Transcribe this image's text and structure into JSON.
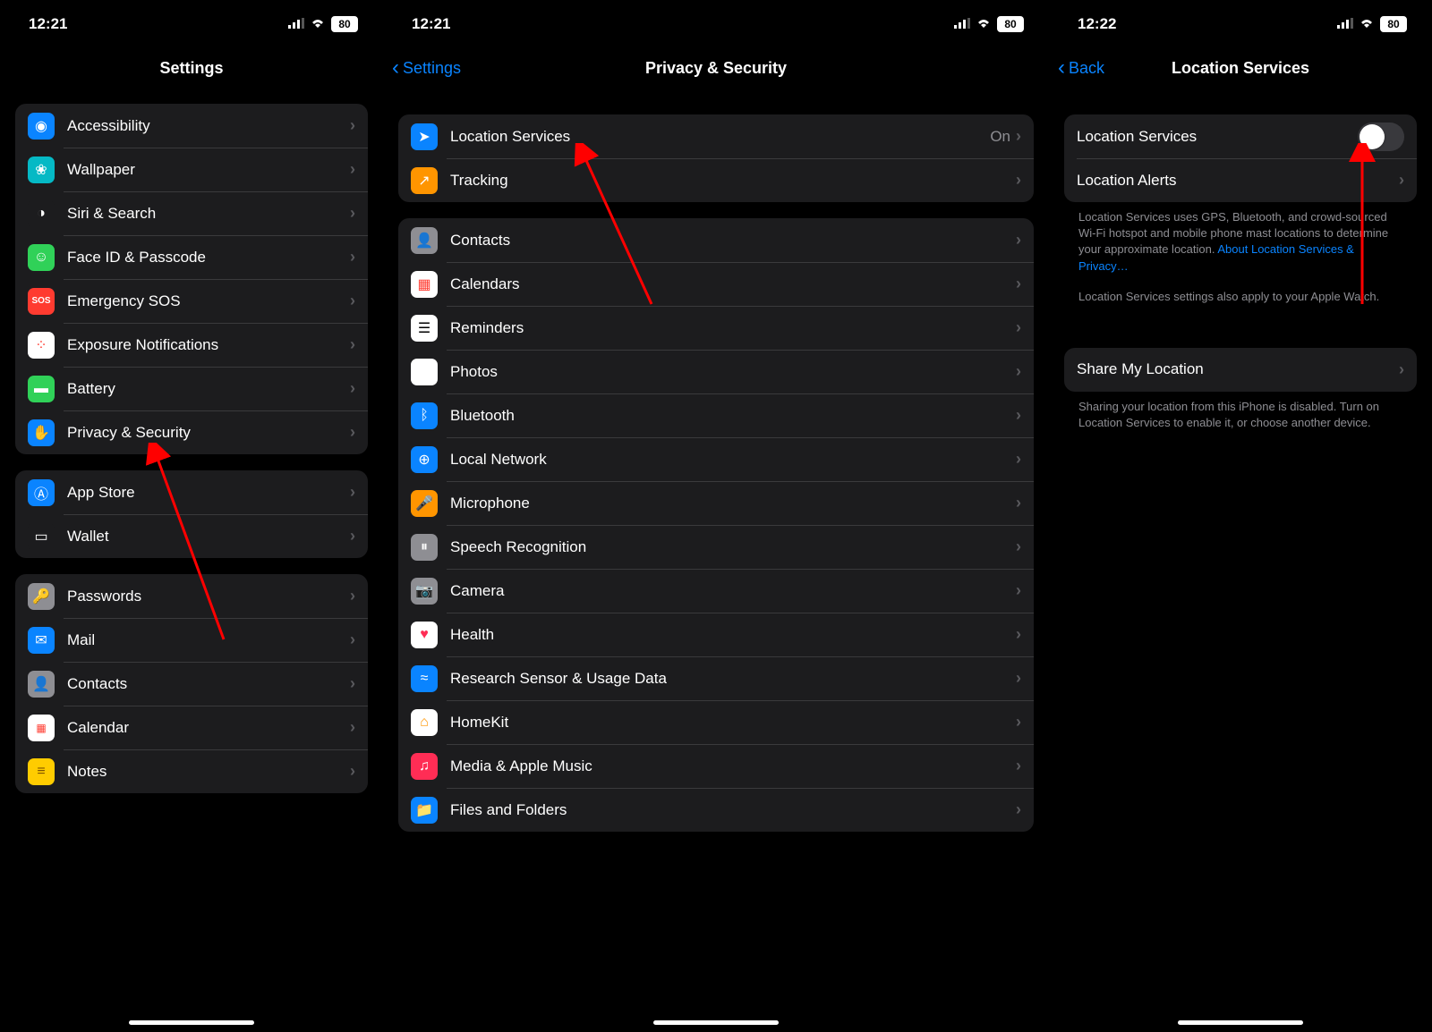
{
  "panels": [
    {
      "status": {
        "time": "12:21",
        "battery": "80"
      },
      "title": "Settings",
      "back": null,
      "groups": [
        {
          "rows": [
            {
              "icon": "accessibility-icon",
              "label": "Accessibility"
            },
            {
              "icon": "wallpaper-icon",
              "label": "Wallpaper"
            },
            {
              "icon": "siri-icon",
              "label": "Siri & Search"
            },
            {
              "icon": "faceid-icon",
              "label": "Face ID & Passcode"
            },
            {
              "icon": "sos-icon",
              "label": "Emergency SOS"
            },
            {
              "icon": "exposure-icon",
              "label": "Exposure Notifications"
            },
            {
              "icon": "battery-icon",
              "label": "Battery"
            },
            {
              "icon": "privacy-icon",
              "label": "Privacy & Security"
            }
          ]
        },
        {
          "rows": [
            {
              "icon": "appstore-icon",
              "label": "App Store"
            },
            {
              "icon": "wallet-icon",
              "label": "Wallet"
            }
          ]
        },
        {
          "rows": [
            {
              "icon": "passwords-icon",
              "label": "Passwords"
            },
            {
              "icon": "mail-icon",
              "label": "Mail"
            },
            {
              "icon": "contacts-icon",
              "label": "Contacts"
            },
            {
              "icon": "calendar-icon",
              "label": "Calendar"
            },
            {
              "icon": "notes-icon",
              "label": "Notes"
            }
          ]
        }
      ]
    },
    {
      "status": {
        "time": "12:21",
        "battery": "80"
      },
      "title": "Privacy & Security",
      "back": "Settings",
      "groups": [
        {
          "rows": [
            {
              "icon": "location-icon",
              "label": "Location Services",
              "value": "On"
            },
            {
              "icon": "tracking-icon",
              "label": "Tracking"
            }
          ]
        },
        {
          "rows": [
            {
              "icon": "contacts-icon",
              "label": "Contacts"
            },
            {
              "icon": "calendar2-icon",
              "label": "Calendars"
            },
            {
              "icon": "reminders-icon",
              "label": "Reminders"
            },
            {
              "icon": "photos-icon",
              "label": "Photos"
            },
            {
              "icon": "bluetooth-icon",
              "label": "Bluetooth"
            },
            {
              "icon": "network-icon",
              "label": "Local Network"
            },
            {
              "icon": "microphone-icon",
              "label": "Microphone"
            },
            {
              "icon": "speech-icon",
              "label": "Speech Recognition"
            },
            {
              "icon": "camera-icon",
              "label": "Camera"
            },
            {
              "icon": "health-icon",
              "label": "Health"
            },
            {
              "icon": "research-icon",
              "label": "Research Sensor & Usage Data"
            },
            {
              "icon": "homekit-icon",
              "label": "HomeKit"
            },
            {
              "icon": "music-icon",
              "label": "Media & Apple Music"
            },
            {
              "icon": "files-icon",
              "label": "Files and Folders"
            }
          ]
        }
      ]
    },
    {
      "status": {
        "time": "12:22",
        "battery": "80"
      },
      "title": "Location Services",
      "back": "Back",
      "groups": [
        {
          "rows": [
            {
              "label": "Location Services",
              "toggle": false
            },
            {
              "label": "Location Alerts",
              "chevron": true
            }
          ],
          "footer": "Location Services uses GPS, Bluetooth, and crowd-sourced Wi-Fi hotspot and mobile phone mast locations to determine your approximate location. ",
          "footer_link": "About Location Services & Privacy…",
          "footer2": "Location Services settings also apply to your Apple Watch."
        },
        {
          "rows": [
            {
              "label": "Share My Location",
              "chevron": true
            }
          ],
          "footer": "Sharing your location from this iPhone is disabled. Turn on Location Services to enable it, or choose another device."
        }
      ]
    }
  ]
}
